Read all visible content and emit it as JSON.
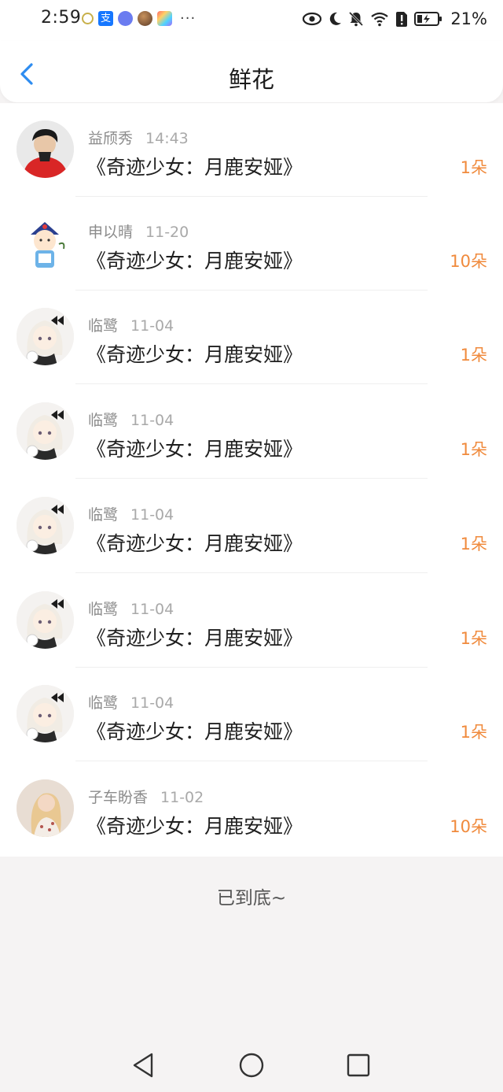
{
  "status": {
    "time": "2:59",
    "battery": "21%"
  },
  "header": {
    "title": "鲜花"
  },
  "items": [
    {
      "name": "益颀秀",
      "date": "14:43",
      "book": "《奇迹少女：月鹿安娅》",
      "count": "1朵",
      "avatar": "avatar-1"
    },
    {
      "name": "申以晴",
      "date": "11-20",
      "book": "《奇迹少女：月鹿安娅》",
      "count": "10朵",
      "avatar": "avatar-2"
    },
    {
      "name": "临鹭",
      "date": "11-04",
      "book": "《奇迹少女：月鹿安娅》",
      "count": "1朵",
      "avatar": "avatar-3"
    },
    {
      "name": "临鹭",
      "date": "11-04",
      "book": "《奇迹少女：月鹿安娅》",
      "count": "1朵",
      "avatar": "avatar-3"
    },
    {
      "name": "临鹭",
      "date": "11-04",
      "book": "《奇迹少女：月鹿安娅》",
      "count": "1朵",
      "avatar": "avatar-3"
    },
    {
      "name": "临鹭",
      "date": "11-04",
      "book": "《奇迹少女：月鹿安娅》",
      "count": "1朵",
      "avatar": "avatar-3"
    },
    {
      "name": "临鹭",
      "date": "11-04",
      "book": "《奇迹少女：月鹿安娅》",
      "count": "1朵",
      "avatar": "avatar-3"
    },
    {
      "name": "子车盼香",
      "date": "11-02",
      "book": "《奇迹少女：月鹿安娅》",
      "count": "10朵",
      "avatar": "avatar-4"
    }
  ],
  "footer": {
    "end_text": "已到底~"
  },
  "colors": {
    "accent": "#2d8cf0",
    "count": "#f08a3c",
    "background": "#f5f3f3"
  },
  "icons": {
    "back": "chevron-left-icon",
    "nav_back": "triangle-back-icon",
    "nav_home": "circle-home-icon",
    "nav_recent": "square-recent-icon"
  }
}
